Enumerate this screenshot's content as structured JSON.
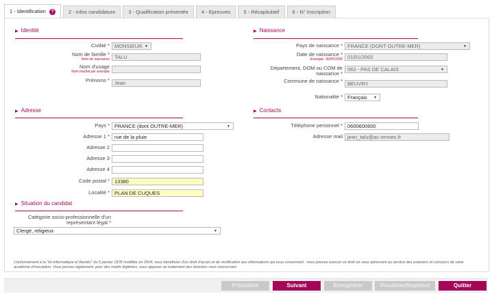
{
  "tabs": [
    {
      "label": "1 - Identification"
    },
    {
      "label": "2 - Infos candidature"
    },
    {
      "label": "3 - Qualification présentée"
    },
    {
      "label": "4 - Epreuves"
    },
    {
      "label": "5 - Récapitulatif"
    },
    {
      "label": "6 - N° Inscription"
    }
  ],
  "help_icon": "?",
  "sections": {
    "identite": "Identité",
    "naissance": "Naissance",
    "adresse": "Adresse",
    "contacts": "Contacts",
    "situation": "Situation du candidat"
  },
  "required_mark": "*",
  "identite": {
    "civilite_label": "Civilité",
    "civilite_value": "MONSIEUR",
    "nom_famille_label": "Nom de famille",
    "nom_famille_hint": "Nom de naissance",
    "nom_famille_value": "TALU",
    "nom_usage_label": "Nom d'usage",
    "nom_usage_hint": "Nom marital par exemple",
    "nom_usage_value": "",
    "prenoms_label": "Prénoms",
    "prenoms_value": "Jean"
  },
  "naissance": {
    "pays_label": "Pays de naissance",
    "pays_value": "FRANCE (DONT OUTRE-MER)",
    "date_label": "Date de naissance",
    "date_hint": "Exemple: 30/05/1990",
    "date_value": "01/01/2002",
    "dept_label_1": "Département, DOM ou COM de",
    "dept_label_2": "naissance",
    "dept_value": "062 - PAS DE CALAIS",
    "commune_label": "Commune de naissance",
    "commune_value": "BEUVRY",
    "nationalite_label": "Nationalité",
    "nationalite_value": "Français"
  },
  "adresse": {
    "pays_label": "Pays",
    "pays_value": "FRANCE (dont OUTRE-MER)",
    "adresse1_label": "Adresse 1",
    "adresse1_value": "rue de la pluie",
    "adresse2_label": "Adresse 2",
    "adresse3_label": "Adresse 3",
    "adresse4_label": "Adresse 4",
    "cp_label": "Code postal",
    "cp_value": "13380",
    "localite_label": "Localité",
    "localite_value": "PLAN DE CUQUES"
  },
  "contacts": {
    "tel_label": "Téléphone personnel",
    "tel_value": "0600600600",
    "mail_label": "Adresse mail",
    "mail_value": "jean_talu@ac-rennes.fr"
  },
  "situation": {
    "categorie_label_1": "Catégorie socio-professionnelle d'un",
    "categorie_label_2": "représentant légal",
    "categorie_value": "Clergé, religieux"
  },
  "notice": "Conformément à la \"loi informatique et libertés\" du 6 janvier 1978 modifiée en 2004, vous bénéficiez d'un droit d'accès et de rectification aux informations qui vous concernent : vous pouvez exercer ce droit en vous adressant au service des examens et concours de votre académie d'inscription. Vous pouvez également, pour des motifs légitimes, vous opposer au traitement des données vous concernant.",
  "buttons": {
    "precedent": "Précédent",
    "suivant": "Suivant",
    "enregistrer": "Enregistrer",
    "visualiser": "Visualiser/Imprimer",
    "quitter": "Quitter"
  },
  "colors": {
    "accent": "#a4065a",
    "readonly_bg": "#ececec",
    "highlight_bg": "#ffffc4"
  }
}
